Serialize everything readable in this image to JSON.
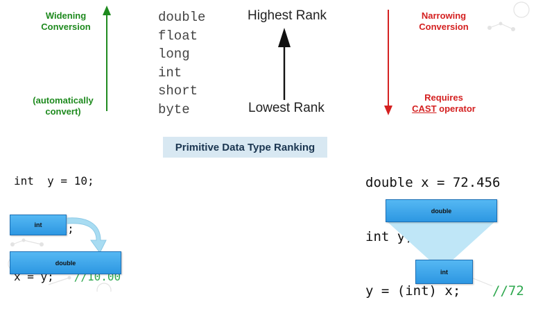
{
  "widening": {
    "title": "Widening Conversion",
    "note": "(automatically convert)"
  },
  "narrowing": {
    "title": "Narrowing Conversion",
    "note_line1": "Requires",
    "note_cast": "CAST",
    "note_rest": " operator"
  },
  "types": [
    "double",
    "float",
    "long",
    "int",
    "short",
    "byte"
  ],
  "rank": {
    "highest": "Highest Rank",
    "lowest": "Lowest Rank"
  },
  "ranking_label": "Primitive Data Type Ranking",
  "code_left": {
    "line1": "int  y = 10;",
    "line2": "double x;",
    "line3": "x = y;   ",
    "comment": "//10.00"
  },
  "code_right": {
    "line1": "double x = 72.456",
    "line2": "int y;",
    "line3": "y = (int) x;    ",
    "comment": "//72"
  },
  "boxes": {
    "left_small": "int",
    "left_large": "double",
    "right_top": "double",
    "right_bottom": "int"
  },
  "colors": {
    "green": "#1e8a1e",
    "red": "#d42020",
    "box_blue": "#3aa5ec",
    "funnel": "#bfe6f7",
    "comment_green": "#2fa84f"
  }
}
